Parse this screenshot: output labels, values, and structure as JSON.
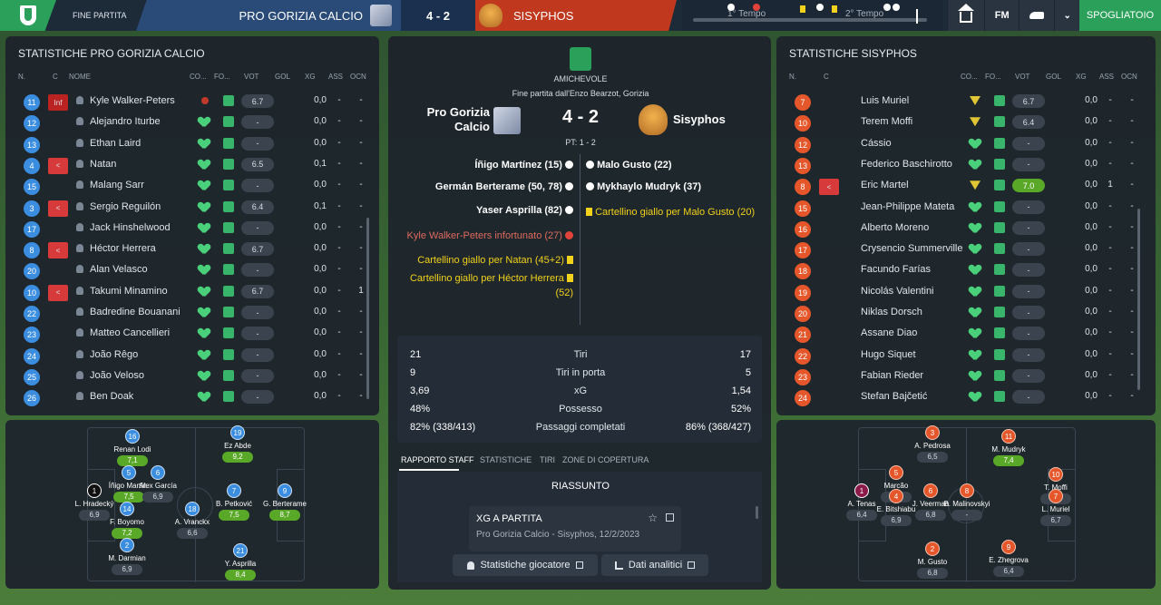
{
  "topbar": {
    "status": "FINE PARTITA",
    "home": "PRO GORIZIA CALCIO",
    "score": "4 - 2",
    "away": "SISYPHOS",
    "first_half": "1° Tempo",
    "second_half": "2° Tempo",
    "fm": "FM",
    "spogliatoio": "SPOGLIATOIO"
  },
  "left": {
    "title": "STATISTICHE PRO GORIZIA CALCIO",
    "cols": {
      "n": "N.",
      "c": "C",
      "nome": "NOME",
      "co": "CO...",
      "fo": "FO...",
      "vot": "VOT",
      "gol": "GOL",
      "xg": "XG",
      "ass": "ASS",
      "ocn": "OCN"
    },
    "rows": [
      {
        "n": "11",
        "c": "Inf",
        "name": "Kyle Walker-Peters",
        "vot": "6.7",
        "gol": "",
        "xg": "0,0",
        "ass": "-",
        "ocn": "-",
        "injured": true
      },
      {
        "n": "12",
        "c": "",
        "name": "Alejandro Iturbe",
        "vot": "-",
        "gol": "",
        "xg": "0,0",
        "ass": "-",
        "ocn": "-"
      },
      {
        "n": "13",
        "c": "",
        "name": "Ethan Laird",
        "vot": "-",
        "gol": "",
        "xg": "0,0",
        "ass": "-",
        "ocn": "-"
      },
      {
        "n": "4",
        "c": "<",
        "name": "Natan",
        "vot": "6.5",
        "gol": "",
        "xg": "0,1",
        "ass": "-",
        "ocn": "-"
      },
      {
        "n": "15",
        "c": "",
        "name": "Malang Sarr",
        "vot": "-",
        "gol": "",
        "xg": "0,0",
        "ass": "-",
        "ocn": "-"
      },
      {
        "n": "3",
        "c": "<",
        "name": "Sergio Reguilón",
        "vot": "6.4",
        "gol": "",
        "xg": "0,1",
        "ass": "-",
        "ocn": "-"
      },
      {
        "n": "17",
        "c": "",
        "name": "Jack Hinshelwood",
        "vot": "-",
        "gol": "",
        "xg": "0,0",
        "ass": "-",
        "ocn": "-"
      },
      {
        "n": "8",
        "c": "<",
        "name": "Héctor Herrera",
        "vot": "6.7",
        "gol": "",
        "xg": "0,0",
        "ass": "-",
        "ocn": "-"
      },
      {
        "n": "20",
        "c": "",
        "name": "Alan Velasco",
        "vot": "-",
        "gol": "",
        "xg": "0,0",
        "ass": "-",
        "ocn": "-"
      },
      {
        "n": "10",
        "c": "<",
        "name": "Takumi Minamino",
        "vot": "6.7",
        "gol": "",
        "xg": "0,0",
        "ass": "-",
        "ocn": "1"
      },
      {
        "n": "22",
        "c": "",
        "name": "Badredine Bouanani",
        "vot": "-",
        "gol": "",
        "xg": "0,0",
        "ass": "-",
        "ocn": "-"
      },
      {
        "n": "23",
        "c": "",
        "name": "Matteo Cancellieri",
        "vot": "-",
        "gol": "",
        "xg": "0,0",
        "ass": "-",
        "ocn": "-"
      },
      {
        "n": "24",
        "c": "",
        "name": "João Rêgo",
        "vot": "-",
        "gol": "",
        "xg": "0,0",
        "ass": "-",
        "ocn": "-"
      },
      {
        "n": "25",
        "c": "",
        "name": "João Veloso",
        "vot": "-",
        "gol": "",
        "xg": "0,0",
        "ass": "-",
        "ocn": "-"
      },
      {
        "n": "26",
        "c": "",
        "name": "Ben Doak",
        "vot": "-",
        "gol": "",
        "xg": "0,0",
        "ass": "-",
        "ocn": "-"
      }
    ],
    "pitch": [
      {
        "num": "16",
        "name": "Renan Lodi",
        "rt": "7,1",
        "g": true
      },
      {
        "num": "19",
        "name": "Ez Abde",
        "rt": "9,2",
        "g": true
      },
      {
        "num": "1",
        "name": "L. Hradecký",
        "rt": "6,9",
        "g": false,
        "gk": true
      },
      {
        "num": "5",
        "name": "Íñigo Martín.",
        "rt": "7,5",
        "g": true
      },
      {
        "num": "6",
        "name": "Alex García",
        "rt": "6,9",
        "g": false
      },
      {
        "num": "14",
        "name": "F. Boyomo",
        "rt": "7,2",
        "g": true
      },
      {
        "num": "18",
        "name": "A. Vranckx",
        "rt": "6,6",
        "g": false
      },
      {
        "num": "7",
        "name": "B. Petković",
        "rt": "7,5",
        "g": true
      },
      {
        "num": "9",
        "name": "G. Berterame",
        "rt": "8,7",
        "g": true
      },
      {
        "num": "2",
        "name": "M. Darmian",
        "rt": "6,9",
        "g": false
      },
      {
        "num": "21",
        "name": "Y. Asprilla",
        "rt": "8,4",
        "g": true
      }
    ]
  },
  "center": {
    "comp": "AMICHEVOLE",
    "venue": "Fine partita dall'Enzo Bearzot, Gorizia",
    "home": "Pro Gorizia Calcio",
    "score": "4 - 2",
    "away": "Sisyphos",
    "ht": "PT: 1 - 2",
    "home_events": [
      {
        "text": "Íñigo Martínez (15)",
        "type": "goal"
      },
      {
        "text": "Germán Berterame (50, 78)",
        "type": "goal"
      },
      {
        "text": "Yaser Asprilla (82)",
        "type": "goal"
      },
      {
        "text": "Kyle Walker-Peters infortunato (27)",
        "type": "inj"
      },
      {
        "text": "Cartellino giallo per Natan (45+2)",
        "type": "yc"
      },
      {
        "text": "Cartellino giallo per Héctor Herrera",
        "type": "yc"
      },
      {
        "text": "(52)",
        "type": "cont"
      }
    ],
    "away_events": [
      {
        "text": "Malo Gusto (22)",
        "type": "goal"
      },
      {
        "text": "Mykhaylo Mudryk (37)",
        "type": "goal"
      },
      {
        "text": "Cartellino giallo per Malo Gusto (20)",
        "type": "yc"
      }
    ],
    "stats": [
      {
        "a": "21",
        "label": "Tiri",
        "b": "17"
      },
      {
        "a": "9",
        "label": "Tiri in porta",
        "b": "5"
      },
      {
        "a": "3,69",
        "label": "xG",
        "b": "1,54"
      },
      {
        "a": "48%",
        "label": "Possesso",
        "b": "52%"
      },
      {
        "a": "82% (338/413)",
        "label": "Passaggi completati",
        "b": "86% (368/427)"
      }
    ],
    "tabs": [
      "RAPPORTO STAFF",
      "STATISTICHE",
      "TIRI",
      "ZONE DI COPERTURA"
    ],
    "riassunto": "RIASSUNTO",
    "xg_card": {
      "title": "XG A PARTITA",
      "sub": "Pro Gorizia Calcio - Sisyphos, 12/2/2023"
    },
    "btn_player": "Statistiche giocatore",
    "btn_data": "Dati analitici"
  },
  "right": {
    "title": "STATISTICHE SISYPHOS",
    "cols": {
      "n": "N.",
      "c": "C",
      "co": "CO...",
      "fo": "FO...",
      "vot": "VOT",
      "gol": "GOL",
      "xg": "XG",
      "ass": "ASS",
      "ocn": "OCN"
    },
    "rows": [
      {
        "n": "7",
        "c": "",
        "name": "Luis Muriel",
        "vot": "6.7",
        "g": false,
        "xg": "0,0",
        "ass": "-",
        "ocn": "-"
      },
      {
        "n": "10",
        "c": "",
        "name": "Terem Moffi",
        "vot": "6.4",
        "g": false,
        "xg": "0,0",
        "ass": "-",
        "ocn": "-"
      },
      {
        "n": "12",
        "c": "",
        "name": "Cássio",
        "vot": "-",
        "g": false,
        "xg": "0,0",
        "ass": "-",
        "ocn": "-"
      },
      {
        "n": "13",
        "c": "",
        "name": "Federico Baschirotto",
        "vot": "-",
        "g": false,
        "xg": "0,0",
        "ass": "-",
        "ocn": "-"
      },
      {
        "n": "8",
        "c": "<",
        "name": "Eric Martel",
        "vot": "7.0",
        "g": true,
        "xg": "0,0",
        "ass": "1",
        "ocn": "-"
      },
      {
        "n": "15",
        "c": "",
        "name": "Jean-Philippe Mateta",
        "vot": "-",
        "g": false,
        "xg": "0,0",
        "ass": "-",
        "ocn": "-"
      },
      {
        "n": "16",
        "c": "",
        "name": "Alberto Moreno",
        "vot": "-",
        "g": false,
        "xg": "0,0",
        "ass": "-",
        "ocn": "-"
      },
      {
        "n": "17",
        "c": "",
        "name": "Crysencio Summerville",
        "vot": "-",
        "g": false,
        "xg": "0,0",
        "ass": "-",
        "ocn": "-"
      },
      {
        "n": "18",
        "c": "",
        "name": "Facundo Farías",
        "vot": "-",
        "g": false,
        "xg": "0,0",
        "ass": "-",
        "ocn": "-"
      },
      {
        "n": "19",
        "c": "",
        "name": "Nicolás Valentini",
        "vot": "-",
        "g": false,
        "xg": "0,0",
        "ass": "-",
        "ocn": "-"
      },
      {
        "n": "20",
        "c": "",
        "name": "Niklas Dorsch",
        "vot": "-",
        "g": false,
        "xg": "0,0",
        "ass": "-",
        "ocn": "-"
      },
      {
        "n": "21",
        "c": "",
        "name": "Assane Diao",
        "vot": "-",
        "g": false,
        "xg": "0,0",
        "ass": "-",
        "ocn": "-"
      },
      {
        "n": "22",
        "c": "",
        "name": "Hugo Siquet",
        "vot": "-",
        "g": false,
        "xg": "0,0",
        "ass": "-",
        "ocn": "-"
      },
      {
        "n": "23",
        "c": "",
        "name": "Fabian Rieder",
        "vot": "-",
        "g": false,
        "xg": "0,0",
        "ass": "-",
        "ocn": "-"
      },
      {
        "n": "24",
        "c": "",
        "name": "Stefan Bajčetić",
        "vot": "-",
        "g": false,
        "xg": "0,0",
        "ass": "-",
        "ocn": "-"
      }
    ],
    "pitch": [
      {
        "num": "3",
        "name": "A. Pedrosa",
        "rt": "6,5",
        "g": false
      },
      {
        "num": "11",
        "name": "M. Mudryk",
        "rt": "7,4",
        "g": true
      },
      {
        "num": "1",
        "name": "A. Tenas",
        "rt": "6,4",
        "g": false,
        "gk": true
      },
      {
        "num": "5",
        "name": "Marcão",
        "rt": "6,5",
        "g": false
      },
      {
        "num": "4",
        "name": "E. Bitshiabu",
        "rt": "6,9",
        "g": false
      },
      {
        "num": "6",
        "name": "J. Veerman",
        "rt": "6,8",
        "g": false
      },
      {
        "num": "8",
        "name": "B. Malinovskyi",
        "rt": "-",
        "g": false
      },
      {
        "num": "10",
        "name": "T. Moffi",
        "rt": "6,4",
        "g": false
      },
      {
        "num": "7",
        "name": "L. Muriel",
        "rt": "6,7",
        "g": false
      },
      {
        "num": "2",
        "name": "M. Gusto",
        "rt": "6,8",
        "g": false
      },
      {
        "num": "9",
        "name": "E. Zhegrova",
        "rt": "6,4",
        "g": false
      }
    ]
  }
}
